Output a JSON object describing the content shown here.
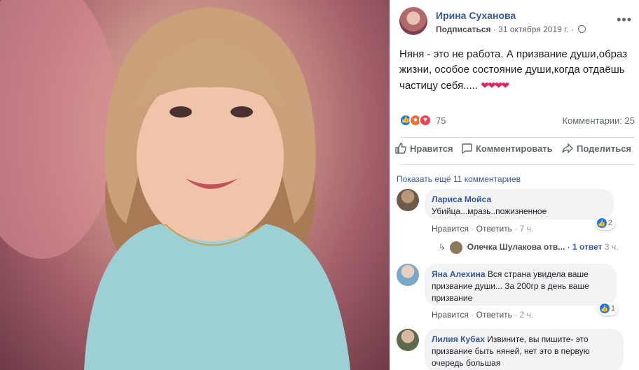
{
  "post": {
    "author": "Ирина Суханова",
    "subscribe": "Подписаться",
    "date": "31 октября 2019 г.",
    "dot": "·",
    "more_icon": "•••",
    "text": "Няня - это не работа. А призвание души,образ жизни, особое состояние души,когда отдаёшь частицу себя.....",
    "hearts": "❤❤❤❤",
    "reaction_count": "75",
    "comments_count": "Комментарии: 25"
  },
  "actions": {
    "like": "Нравится",
    "comment": "Комментировать",
    "share": "Поделиться"
  },
  "show_more": "Показать ещё 11 комментариев",
  "comments": [
    {
      "name": "Лариса Мойса",
      "text": "Убийца...мразь..пожизненное",
      "like": "Нравится",
      "reply": "Ответить",
      "time": "7 ч.",
      "likes": "2"
    },
    {
      "name": "Яна Алехина",
      "text": "Вся страна увидела ваше призвание души... За 200гр в день ваше призвание",
      "like": "Нравится",
      "reply": "Ответить",
      "time": "2 ч.",
      "likes": "1"
    },
    {
      "name": "Лилия Кубах",
      "text": "Извините, вы пишите- это призвание быть няней, нет это в первую очередь большая"
    }
  ],
  "reply_summary": {
    "author": "Олечка Шулакова отв...",
    "count": "1 ответ",
    "time": "3 ч."
  },
  "colors": {
    "link": "#385898",
    "like_blue": "#1877f2",
    "heart_red": "#e0245e"
  },
  "icons": {
    "more": "more-icon",
    "globe": "globe-icon",
    "like": "thumbs-up-icon",
    "comment": "comment-bubble-icon",
    "share": "share-arrow-icon",
    "reply": "reply-arrow-icon"
  }
}
